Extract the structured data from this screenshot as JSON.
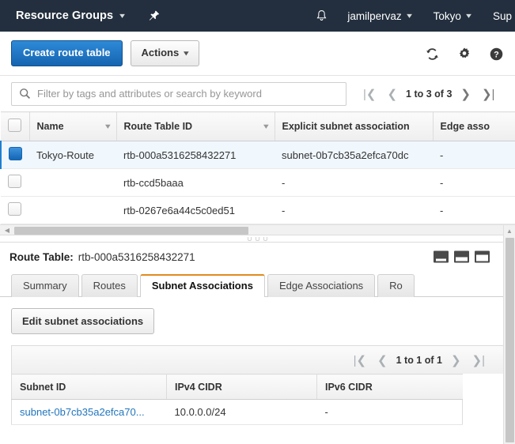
{
  "topnav": {
    "resource_groups_label": "Resource Groups",
    "pin_icon": "pushpin-icon",
    "bell_icon": "notification-bell-icon",
    "user_label": "jamilpervaz",
    "region_label": "Tokyo",
    "support_label": "Sup",
    "caret": "▾"
  },
  "toolbar": {
    "create_label": "Create route table",
    "actions_label": "Actions",
    "actions_caret": "▾",
    "refresh_icon": "refresh-icon",
    "settings_icon": "gear-icon",
    "help_icon": "help-icon"
  },
  "filter": {
    "search_icon": "search-icon",
    "placeholder": "Filter by tags and attributes or search by keyword",
    "value": "",
    "pager": {
      "first": "|❮",
      "prev": "❮",
      "label": "1 to 3 of 3",
      "next": "❯",
      "last": "❯|"
    }
  },
  "grid": {
    "columns": [
      {
        "label": "",
        "sortable": false
      },
      {
        "label": "Name",
        "sortable": true
      },
      {
        "label": "Route Table ID",
        "sortable": true
      },
      {
        "label": "Explicit subnet association",
        "sortable": false
      },
      {
        "label": "Edge asso",
        "sortable": false
      }
    ],
    "sort_caret": "▾",
    "rows": [
      {
        "selected": true,
        "name": "Tokyo-Route",
        "route_table_id": "rtb-000a5316258432271",
        "explicit_subnet_association": "subnet-0b7cb35a2efca70dc",
        "edge_association": "-"
      },
      {
        "selected": false,
        "name": "",
        "route_table_id": "rtb-ccd5baaa",
        "explicit_subnet_association": "-",
        "edge_association": "-"
      },
      {
        "selected": false,
        "name": "",
        "route_table_id": "rtb-0267e6a44c5c0ed51",
        "explicit_subnet_association": "-",
        "edge_association": "-"
      }
    ]
  },
  "detail": {
    "label": "Route Table:",
    "value": "rtb-000a5316258432271",
    "layout_buttons": [
      "layout-small-icon",
      "layout-medium-icon",
      "layout-large-icon"
    ],
    "tabs": [
      {
        "label": "Summary",
        "active": false
      },
      {
        "label": "Routes",
        "active": false
      },
      {
        "label": "Subnet Associations",
        "active": true
      },
      {
        "label": "Edge Associations",
        "active": false
      },
      {
        "label": "Ro",
        "active": false
      }
    ],
    "edit_button_label": "Edit subnet associations",
    "inner_pager": {
      "first": "|❮",
      "prev": "❮",
      "label": "1 to 1 of 1",
      "next": "❯",
      "last": "❯|"
    },
    "inner_table": {
      "columns": [
        "Subnet ID",
        "IPv4 CIDR",
        "IPv6 CIDR"
      ],
      "rows": [
        {
          "subnet_id": "subnet-0b7cb35a2efca70...",
          "ipv4_cidr": "10.0.0.0/24",
          "ipv6_cidr": "-"
        }
      ]
    }
  },
  "colors": {
    "nav_bg": "#232f3e",
    "primary_button": "#1a73c4",
    "active_tab_accent": "#e08b1b",
    "link": "#2176bd",
    "selected_row": "#f0f7fd"
  }
}
